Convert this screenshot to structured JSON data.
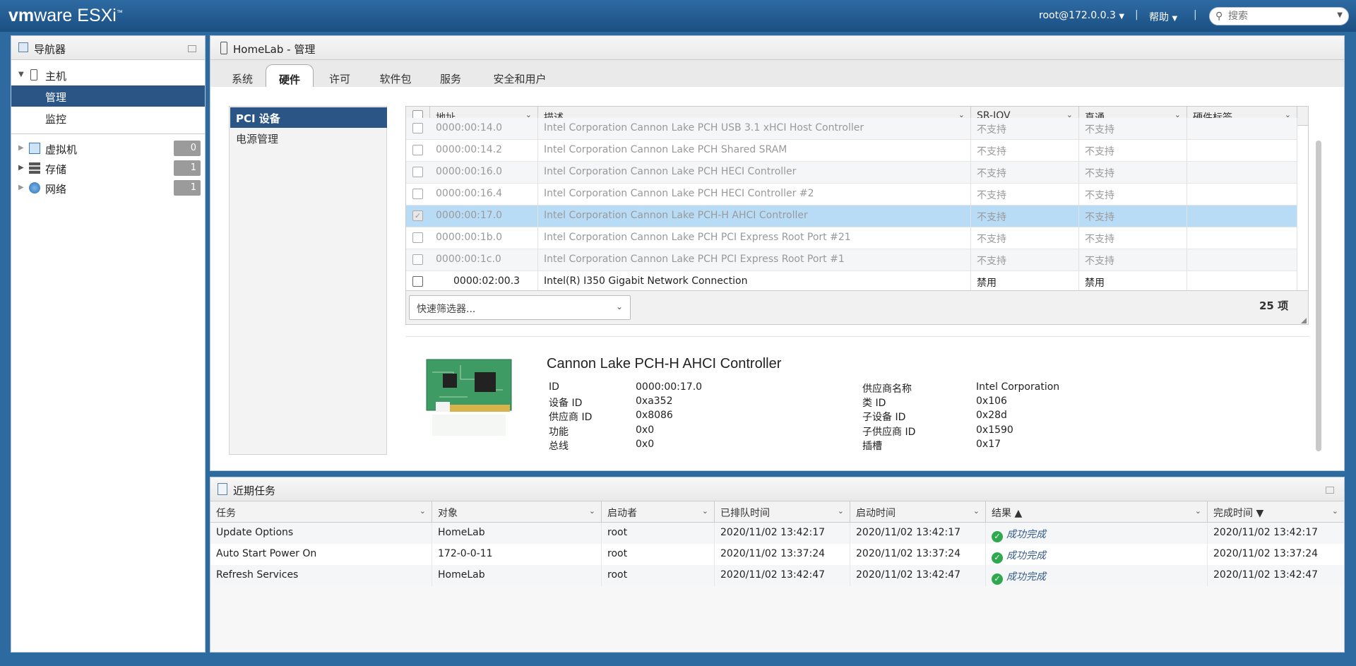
{
  "brand": {
    "vm": "vm",
    "ware": "ware",
    "product": "ESXi",
    "tm": "™"
  },
  "topbar": {
    "user": "root@172.0.0.3",
    "help": "帮助",
    "search_placeholder": "搜索",
    "separator": "|"
  },
  "navigator": {
    "title": "导航器",
    "host": "主机",
    "manage": "管理",
    "monitor": "监控",
    "items": [
      {
        "label": "虚拟机",
        "count": "0"
      },
      {
        "label": "存储",
        "count": "1"
      },
      {
        "label": "网络",
        "count": "1"
      }
    ]
  },
  "main": {
    "title": "HomeLab - 管理",
    "tabs": [
      "系统",
      "硬件",
      "许可",
      "软件包",
      "服务",
      "安全和用户"
    ],
    "subnav": [
      "PCI 设备",
      "电源管理"
    ]
  },
  "pci": {
    "columns": [
      "地址",
      "描述",
      "SR-IOV",
      "直通",
      "硬件标签"
    ],
    "rows": [
      {
        "addr": "0000:00:14.0",
        "desc": "Intel Corporation Cannon Lake PCH USB 3.1 xHCI Host Controller",
        "sriov": "不支持",
        "pass": "不支持"
      },
      {
        "addr": "0000:00:14.2",
        "desc": "Intel Corporation Cannon Lake PCH Shared SRAM",
        "sriov": "不支持",
        "pass": "不支持"
      },
      {
        "addr": "0000:00:16.0",
        "desc": "Intel Corporation Cannon Lake PCH HECI Controller",
        "sriov": "不支持",
        "pass": "不支持"
      },
      {
        "addr": "0000:00:16.4",
        "desc": "Intel Corporation Cannon Lake PCH HECI Controller #2",
        "sriov": "不支持",
        "pass": "不支持"
      },
      {
        "addr": "0000:00:17.0",
        "desc": "Intel Corporation Cannon Lake PCH-H AHCI Controller",
        "sriov": "不支持",
        "pass": "不支持"
      },
      {
        "addr": "0000:00:1b.0",
        "desc": "Intel Corporation Cannon Lake PCH PCI Express Root Port #21",
        "sriov": "不支持",
        "pass": "不支持"
      },
      {
        "addr": "0000:00:1c.0",
        "desc": "Intel Corporation Cannon Lake PCH PCI Express Root Port #1",
        "sriov": "不支持",
        "pass": "不支持"
      },
      {
        "addr": "0000:02:00.3",
        "desc": "Intel(R) I350 Gigabit Network Connection",
        "sriov": "禁用",
        "pass": "禁用"
      }
    ],
    "quick_filter": "快速筛选器...",
    "count": "25 项"
  },
  "detail": {
    "title": "Cannon Lake PCH-H AHCI Controller",
    "left": [
      {
        "k": "ID",
        "v": "0000:00:17.0"
      },
      {
        "k": "设备 ID",
        "v": "0xa352"
      },
      {
        "k": "供应商 ID",
        "v": "0x8086"
      },
      {
        "k": "功能",
        "v": "0x0"
      },
      {
        "k": "总线",
        "v": "0x0"
      }
    ],
    "right": [
      {
        "k": "供应商名称",
        "v": "Intel Corporation"
      },
      {
        "k": "类 ID",
        "v": "0x106"
      },
      {
        "k": "子设备 ID",
        "v": "0x28d"
      },
      {
        "k": "子供应商 ID",
        "v": "0x1590"
      },
      {
        "k": "插槽",
        "v": "0x17"
      }
    ]
  },
  "tasks": {
    "title": "近期任务",
    "columns": [
      "任务",
      "对象",
      "启动者",
      "已排队时间",
      "启动时间",
      "结果 ▲",
      "完成时间 ▼"
    ],
    "rows": [
      {
        "task": "Update Options",
        "target": "HomeLab",
        "initiator": "root",
        "queued": "2020/11/02 13:42:17",
        "started": "2020/11/02 13:42:17",
        "result": "成功完成",
        "completed": "2020/11/02 13:42:17"
      },
      {
        "task": "Auto Start Power On",
        "target": "172-0-0-11",
        "initiator": "root",
        "queued": "2020/11/02 13:37:24",
        "started": "2020/11/02 13:37:24",
        "result": "成功完成",
        "completed": "2020/11/02 13:37:24"
      },
      {
        "task": "Refresh Services",
        "target": "HomeLab",
        "initiator": "root",
        "queued": "2020/11/02 13:42:47",
        "started": "2020/11/02 13:42:47",
        "result": "成功完成",
        "completed": "2020/11/02 13:42:47"
      }
    ]
  },
  "colors": {
    "topbar": "#1f5a8f",
    "selection": "#2a5585",
    "row_selected": "#b9dcf6",
    "success": "#2fa84f"
  }
}
